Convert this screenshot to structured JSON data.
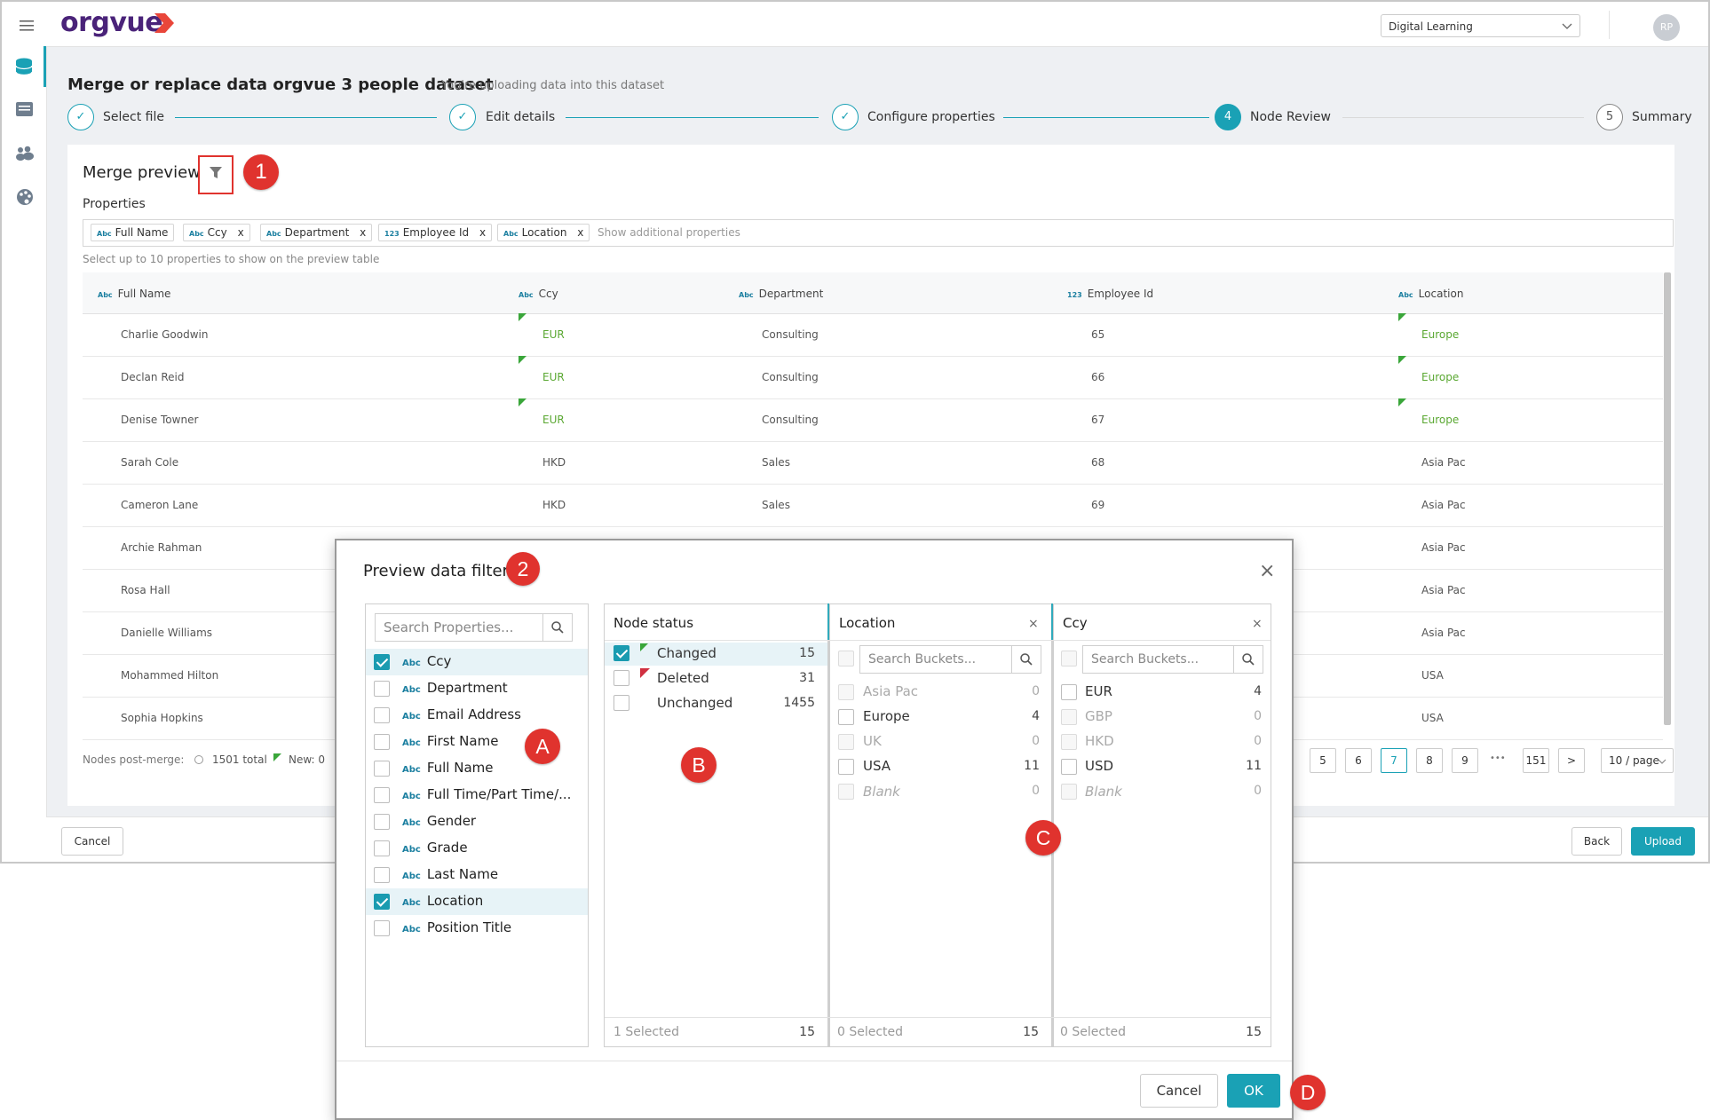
{
  "app": {
    "logo_text": "orgvue",
    "workspace": "Digital Learning",
    "avatar_initials": "RP"
  },
  "page": {
    "title": "Merge or replace data orgvue 3 people dataset",
    "subtitle": "You're uploading data into this dataset"
  },
  "steps": [
    {
      "label": "Select file",
      "marker": "✓"
    },
    {
      "label": "Edit details",
      "marker": "✓"
    },
    {
      "label": "Configure properties",
      "marker": "✓"
    },
    {
      "label": "Node Review",
      "marker": "4"
    },
    {
      "label": "Summary",
      "marker": "5"
    }
  ],
  "merge_preview": {
    "title": "Merge preview",
    "properties_label": "Properties",
    "chips": [
      {
        "type": "Abc",
        "label": "Full Name",
        "removable": false
      },
      {
        "type": "Abc",
        "label": "Ccy",
        "removable": true
      },
      {
        "type": "Abc",
        "label": "Department",
        "removable": true
      },
      {
        "type": "123",
        "label": "Employee Id",
        "removable": true
      },
      {
        "type": "Abc",
        "label": "Location",
        "removable": true
      }
    ],
    "chip_remove": "x",
    "show_additional_placeholder": "Show additional properties",
    "hint": "Select up to 10 properties to show on the preview table",
    "columns": [
      {
        "type": "Abc",
        "label": "Full Name"
      },
      {
        "type": "Abc",
        "label": "Ccy"
      },
      {
        "type": "Abc",
        "label": "Department"
      },
      {
        "type": "123",
        "label": "Employee Id"
      },
      {
        "type": "Abc",
        "label": "Location"
      }
    ],
    "rows": [
      {
        "name": "Charlie Goodwin",
        "ccy": "EUR",
        "dept": "Consulting",
        "id": "65",
        "loc": "Europe",
        "changed": true
      },
      {
        "name": "Declan Reid",
        "ccy": "EUR",
        "dept": "Consulting",
        "id": "66",
        "loc": "Europe",
        "changed": true
      },
      {
        "name": "Denise Towner",
        "ccy": "EUR",
        "dept": "Consulting",
        "id": "67",
        "loc": "Europe",
        "changed": true
      },
      {
        "name": "Sarah Cole",
        "ccy": "HKD",
        "dept": "Sales",
        "id": "68",
        "loc": "Asia Pac",
        "changed": false
      },
      {
        "name": "Cameron Lane",
        "ccy": "HKD",
        "dept": "Sales",
        "id": "69",
        "loc": "Asia Pac",
        "changed": false
      },
      {
        "name": "Archie Rahman",
        "loc": "Asia Pac"
      },
      {
        "name": "Rosa Hall",
        "loc": "Asia Pac"
      },
      {
        "name": "Danielle Williams",
        "loc": "Asia Pac"
      },
      {
        "name": "Mohammed Hilton",
        "loc": "USA"
      },
      {
        "name": "Sophia Hopkins",
        "loc": "USA"
      }
    ],
    "nodes_post_merge": "Nodes post-merge:",
    "total": "1501 total",
    "new": "New: 0",
    "pages": [
      "5",
      "6",
      "7",
      "8",
      "9",
      "•••",
      "151"
    ],
    "current_page": "7",
    "next": ">",
    "per_page": "10 / page"
  },
  "footer": {
    "cancel": "Cancel",
    "back": "Back",
    "upload": "Upload"
  },
  "filter_dialog": {
    "title": "Preview data filter",
    "close": "×",
    "search_properties_placeholder": "Search Properties...",
    "properties": [
      {
        "label": "Ccy",
        "checked": true
      },
      {
        "label": "Department",
        "checked": false
      },
      {
        "label": "Email Address",
        "checked": false
      },
      {
        "label": "First Name",
        "checked": false
      },
      {
        "label": "Full Name",
        "checked": false
      },
      {
        "label": "Full Time/Part Time/...",
        "checked": false
      },
      {
        "label": "Gender",
        "checked": false
      },
      {
        "label": "Grade",
        "checked": false
      },
      {
        "label": "Last Name",
        "checked": false
      },
      {
        "label": "Location",
        "checked": true
      },
      {
        "label": "Position Title",
        "checked": false
      }
    ],
    "type_abc": "Abc",
    "node_status": {
      "title": "Node status",
      "items": [
        {
          "label": "Changed",
          "count": "15",
          "checked": true,
          "flag": "green"
        },
        {
          "label": "Deleted",
          "count": "31",
          "checked": false,
          "flag": "red"
        },
        {
          "label": "Unchanged",
          "count": "1455",
          "checked": false,
          "flag": "none"
        }
      ],
      "footer_selected": "1 Selected",
      "footer_count": "15"
    },
    "location": {
      "title": "Location",
      "search_placeholder": "Search Buckets...",
      "items": [
        {
          "label": "Asia Pac",
          "count": "0",
          "enabled": false
        },
        {
          "label": "Europe",
          "count": "4",
          "enabled": true
        },
        {
          "label": "UK",
          "count": "0",
          "enabled": false
        },
        {
          "label": "USA",
          "count": "11",
          "enabled": true
        },
        {
          "label": "Blank",
          "count": "0",
          "enabled": false
        }
      ],
      "footer_selected": "0 Selected",
      "footer_count": "15"
    },
    "ccy": {
      "title": "Ccy",
      "search_placeholder": "Search Buckets...",
      "items": [
        {
          "label": "EUR",
          "count": "4",
          "enabled": true
        },
        {
          "label": "GBP",
          "count": "0",
          "enabled": false
        },
        {
          "label": "HKD",
          "count": "0",
          "enabled": false
        },
        {
          "label": "USD",
          "count": "11",
          "enabled": true
        },
        {
          "label": "Blank",
          "count": "0",
          "enabled": false
        }
      ],
      "footer_selected": "0 Selected",
      "footer_count": "15"
    },
    "cancel": "Cancel",
    "ok": "OK"
  },
  "callouts": [
    "1",
    "2",
    "A",
    "B",
    "C",
    "D"
  ],
  "colors": {
    "accent": "#1aa1b5",
    "brand": "#4a2379",
    "callout": "#e0332e",
    "changed_flag": "#3aa63a",
    "deleted_flag": "#d03040"
  }
}
